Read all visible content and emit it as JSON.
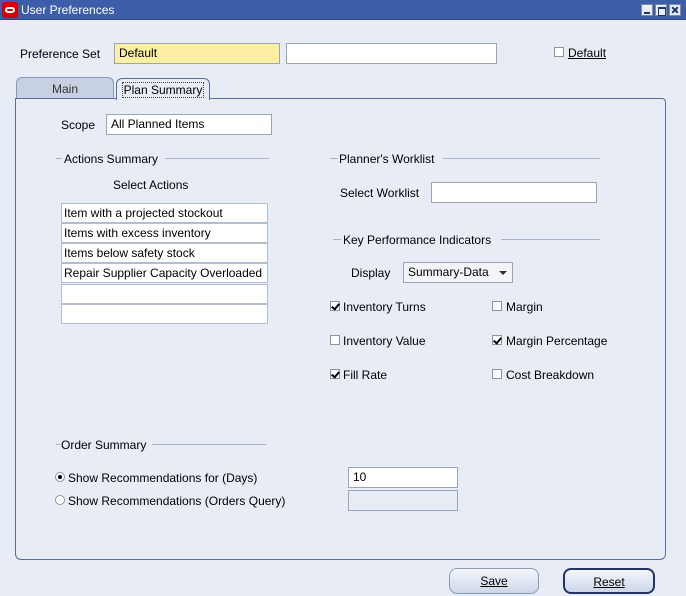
{
  "window": {
    "title": "User Preferences",
    "icon": "oracle-logo-icon"
  },
  "header": {
    "preference_set_label": "Preference Set",
    "preference_set_value": "Default",
    "preference_desc_value": "",
    "default_label": "Default",
    "default_checked": false
  },
  "tabs": [
    {
      "label": "Main",
      "active": false
    },
    {
      "label": "Plan Summary",
      "active": true
    }
  ],
  "scope": {
    "label": "Scope",
    "value": "All Planned Items"
  },
  "actions_summary": {
    "title": "Actions Summary",
    "subtitle": "Select Actions",
    "items": [
      "Item with a projected stockout",
      "Items with excess inventory",
      "Items below safety stock",
      "Repair Supplier Capacity Overloaded",
      "",
      ""
    ]
  },
  "worklist": {
    "title": "Planner's Worklist",
    "select_label": "Select Worklist",
    "select_value": ""
  },
  "kpi": {
    "title": "Key Performance Indicators",
    "display_label": "Display",
    "display_value": "Summary-Data",
    "checkboxes": [
      {
        "label": "Inventory Turns",
        "checked": true
      },
      {
        "label": "Margin",
        "checked": false
      },
      {
        "label": "Inventory Value",
        "checked": false
      },
      {
        "label": "Margin Percentage",
        "checked": true
      },
      {
        "label": "Fill Rate",
        "checked": true
      },
      {
        "label": "Cost Breakdown",
        "checked": false
      }
    ]
  },
  "order_summary": {
    "title": "Order Summary",
    "options": [
      {
        "label": "Show Recommendations for (Days)",
        "selected": true,
        "value": "10"
      },
      {
        "label": "Show Recommendations (Orders Query)",
        "selected": false,
        "value": ""
      }
    ]
  },
  "buttons": {
    "save": "Save",
    "reset": "Reset"
  },
  "colors": {
    "titlebar": "#3d5da8",
    "required_field": "#fcefa1",
    "background": "#e8ecf5"
  }
}
